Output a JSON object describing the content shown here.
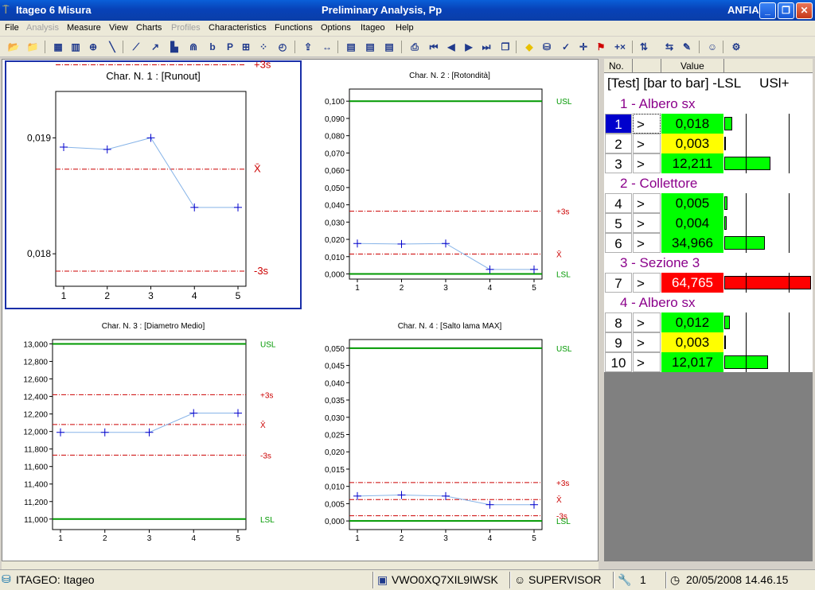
{
  "window": {
    "app_title": "Itageo 6 Misura",
    "doc_title": "Preliminary Analysis, Pp",
    "right_label": "ANFIA"
  },
  "menu": [
    "File",
    "Analysis",
    "Measure",
    "View",
    "Charts",
    "Profiles",
    "Characteristics",
    "Functions",
    "Options",
    "Itageo",
    "Help"
  ],
  "menu_disabled": [
    "Analysis",
    "Profiles"
  ],
  "toolbar_icons": [
    "open-folder-icon",
    "folder-icon",
    "chart-grid-icon",
    "bars-icon",
    "target-icon",
    "pen-icon",
    "line-chart-icon",
    "regression-icon",
    "histogram-icon",
    "distribution-icon",
    "b-text-icon",
    "p-text-icon",
    "xy-icon",
    "scatter-icon",
    "clock-icon",
    "export-icon",
    "width-icon",
    "notes-icon",
    "notes2-icon",
    "notes3-icon",
    "print-icon",
    "first-icon",
    "prev-icon",
    "next-icon",
    "last-icon",
    "copy-icon",
    "warning-icon",
    "database-icon",
    "check-icon",
    "crosshair-icon",
    "flag-icon",
    "plus-x-icon",
    "sort-icon",
    "compare-icon",
    "chart-edit-icon",
    "user-icon",
    "settings-icon"
  ],
  "chart_data": [
    {
      "type": "line",
      "title": "Char. N. 1 : [Runout]",
      "x": [
        1,
        2,
        3,
        4,
        5
      ],
      "values": [
        0.01892,
        0.0189,
        0.019,
        0.0184,
        0.0184
      ],
      "ylim": [
        0.01772,
        0.0194
      ],
      "yticks": [
        0.018,
        0.019
      ],
      "ytick_labels": [
        "0,018",
        "0,019"
      ],
      "ref_lines": [
        {
          "label": "+3s",
          "value": 0.01963,
          "style": "dash"
        },
        {
          "label": "X̄",
          "value": 0.01873,
          "style": "dash"
        },
        {
          "label": "-3s",
          "value": 0.01785,
          "style": "dash"
        }
      ],
      "selected": true,
      "title_size": 13
    },
    {
      "type": "line",
      "title": "Char. N. 2 : [Rotondità]",
      "x": [
        1,
        2,
        3,
        4,
        5
      ],
      "values": [
        0.0176,
        0.0173,
        0.0176,
        0.0026,
        0.0026
      ],
      "ylim": [
        -0.003,
        0.107
      ],
      "yticks": [
        0,
        0.01,
        0.02,
        0.03,
        0.04,
        0.05,
        0.06,
        0.07,
        0.08,
        0.09,
        0.1
      ],
      "ytick_labels": [
        "0,000",
        "0,010",
        "0,020",
        "0,030",
        "0,040",
        "0,050",
        "0,060",
        "0,070",
        "0,080",
        "0,090",
        "0,100"
      ],
      "ref_lines": [
        {
          "label": "USL",
          "value": 0.1,
          "style": "solid"
        },
        {
          "label": "+3s",
          "value": 0.0363,
          "style": "dash"
        },
        {
          "label": "X̄",
          "value": 0.0115,
          "style": "dash"
        },
        {
          "label": "LSL",
          "value": 0,
          "style": "solid"
        }
      ],
      "title_size": 10
    },
    {
      "type": "line",
      "title": "Char. N. 3 : [Diametro Medio]",
      "x": [
        1,
        2,
        3,
        4,
        5
      ],
      "values": [
        11.99,
        11.99,
        11.99,
        12.21,
        12.21
      ],
      "ylim": [
        10.88,
        13.05
      ],
      "yticks": [
        11,
        11.2,
        11.4,
        11.6,
        11.8,
        12,
        12.2,
        12.4,
        12.6,
        12.8,
        13
      ],
      "ytick_labels": [
        "11,000",
        "11,200",
        "11,400",
        "11,600",
        "11,800",
        "12,000",
        "12,200",
        "12,400",
        "12,600",
        "12,800",
        "13,000"
      ],
      "ref_lines": [
        {
          "label": "USL",
          "value": 13,
          "style": "solid"
        },
        {
          "label": "+3s",
          "value": 12.42,
          "style": "dash"
        },
        {
          "label": "X̄",
          "value": 12.08,
          "style": "dash"
        },
        {
          "label": "-3s",
          "value": 11.73,
          "style": "dash"
        },
        {
          "label": "LSL",
          "value": 11,
          "style": "solid"
        }
      ],
      "title_size": 10
    },
    {
      "type": "line",
      "title": "Char. N. 4 : [Salto lama MAX]",
      "x": [
        1,
        2,
        3,
        4,
        5
      ],
      "values": [
        0.0072,
        0.0075,
        0.0072,
        0.0047,
        0.0047
      ],
      "ylim": [
        -0.0025,
        0.0525
      ],
      "yticks": [
        0,
        0.005,
        0.01,
        0.015,
        0.02,
        0.025,
        0.03,
        0.035,
        0.04,
        0.045,
        0.05
      ],
      "ytick_labels": [
        "0,000",
        "0,005",
        "0,010",
        "0,015",
        "0,020",
        "0,025",
        "0,030",
        "0,035",
        "0,040",
        "0,045",
        "0,050"
      ],
      "ref_lines": [
        {
          "label": "USL",
          "value": 0.05,
          "style": "solid"
        },
        {
          "label": "+3s",
          "value": 0.0111,
          "style": "dash"
        },
        {
          "label": "X̄",
          "value": 0.0062,
          "style": "dash"
        },
        {
          "label": "-3s",
          "value": 0.0015,
          "style": "dash"
        },
        {
          "label": "LSL",
          "value": 0,
          "style": "solid"
        }
      ],
      "title_size": 10
    }
  ],
  "table": {
    "col_no": "No.",
    "col_value": "Value",
    "subheader": "[Test] [bar to bar] -LSL     USl+",
    "rows": [
      {
        "kind": "group",
        "label": "1 - Albero sx"
      },
      {
        "kind": "data",
        "no": "1",
        "arrow": ">",
        "value": "0,018",
        "color": "#00ff00",
        "bar": 0.09,
        "barcolor": "#00ff00",
        "selected": true
      },
      {
        "kind": "data",
        "no": "2",
        "arrow": ">",
        "value": "0,003",
        "color": "#ffff00",
        "bar": 0.01,
        "barcolor": "#ffff00"
      },
      {
        "kind": "data",
        "no": "3",
        "arrow": ">",
        "value": "12,211",
        "color": "#00ff00",
        "bar": 0.53,
        "barcolor": "#00ff00"
      },
      {
        "kind": "group",
        "label": "2 - Collettore"
      },
      {
        "kind": "data",
        "no": "4",
        "arrow": ">",
        "value": "0,005",
        "color": "#00ff00",
        "bar": 0.04,
        "barcolor": "#00ff00"
      },
      {
        "kind": "data",
        "no": "5",
        "arrow": ">",
        "value": "0,004",
        "color": "#00ff00",
        "bar": 0.03,
        "barcolor": "#00ff00"
      },
      {
        "kind": "data",
        "no": "6",
        "arrow": ">",
        "value": "34,966",
        "color": "#00ff00",
        "bar": 0.47,
        "barcolor": "#00ff00"
      },
      {
        "kind": "group",
        "label": "3 - Sezione 3"
      },
      {
        "kind": "data",
        "no": "7",
        "arrow": ">",
        "value": "64,765",
        "color": "#ff0000",
        "bar": 1.0,
        "barcolor": "#ff0000",
        "textcolor": "#ffffff"
      },
      {
        "kind": "group",
        "label": "4 - Albero sx"
      },
      {
        "kind": "data",
        "no": "8",
        "arrow": ">",
        "value": "0,012",
        "color": "#00ff00",
        "bar": 0.06,
        "barcolor": "#00ff00"
      },
      {
        "kind": "data",
        "no": "9",
        "arrow": ">",
        "value": "0,003",
        "color": "#ffff00",
        "bar": 0.01,
        "barcolor": "#ffff00"
      },
      {
        "kind": "data",
        "no": "10",
        "arrow": ">",
        "value": "12,017",
        "color": "#00ff00",
        "bar": 0.5,
        "barcolor": "#00ff00"
      }
    ]
  },
  "status": {
    "db": "ITAGEO: Itageo",
    "machine": "VWO0XQ7XIL9IWSK",
    "user": "SUPERVISOR",
    "count": "1",
    "datetime": "20/05/2008 14.46.15"
  },
  "colors": {
    "group_text": "#8b008b",
    "spec_line": "#009900",
    "ref_line": "#cc0000",
    "series": "#87b4e8",
    "marker": "#0000cc",
    "selected_row": "#0000cc"
  }
}
